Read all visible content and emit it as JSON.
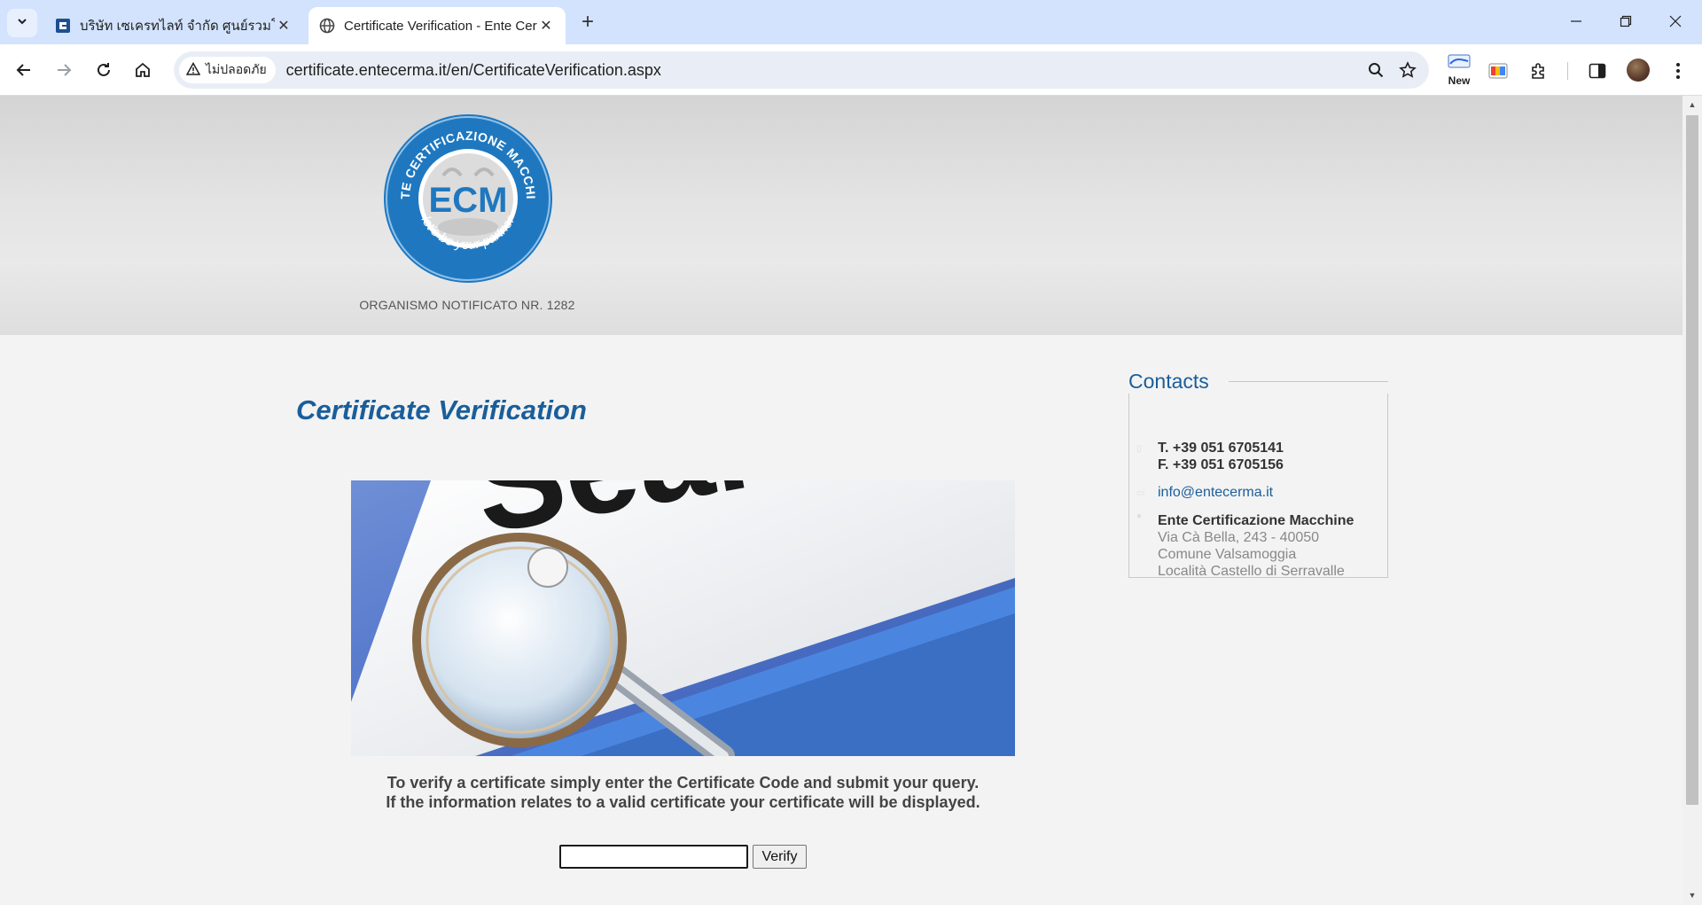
{
  "browser": {
    "tabs": [
      {
        "title": "บริษัท เซเครทไลท์ จำกัด ศูนย์รวมโคมไฟ",
        "active": false
      },
      {
        "title": "Certificate Verification - Ente Certificazione Macchine",
        "active": true
      }
    ],
    "address_bar": {
      "security_label": "ไม่ปลอดภัย",
      "url": "certificate.entecerma.it/en/CertificateVerification.aspx"
    },
    "extension_badge_label": "New",
    "icons": [
      "tab-search-icon",
      "close-icon",
      "new-tab-icon",
      "minimize-icon",
      "restore-icon",
      "back-icon",
      "forward-icon",
      "reload-icon",
      "home-icon",
      "warning-icon",
      "search-icon",
      "star-icon",
      "extensions-icon",
      "side-panel-icon",
      "menu-icon"
    ]
  },
  "header": {
    "logo": {
      "ring_text_top": "ENTE CERTIFICAZIONE MACCHINE",
      "ring_text_bottom": "let's be your partner",
      "center_text": "ECM"
    },
    "notified_body": "ORGANISMO NOTIFICATO NR. 1282"
  },
  "main": {
    "title": "Certificate Verification",
    "hero_image_text": "Search...",
    "instructions_line1": "To verify a certificate simply enter the Certificate Code and submit your query.",
    "instructions_line2": "If the information relates to a valid certificate your certificate will be displayed.",
    "input": {
      "value": "",
      "placeholder": ""
    },
    "verify_label": "Verify"
  },
  "contacts": {
    "title": "Contacts",
    "phone": "T. +39 051 6705141",
    "fax": "F. +39 051 6705156",
    "email": "info@entecerma.it",
    "company": "Ente Certificazione Macchine",
    "address_line1": "Via Cà Bella, 243 - 40050",
    "address_line2": "Comune Valsamoggia",
    "address_line3": "Località Castello di Serravalle"
  },
  "colors": {
    "accent": "#1a5e9a",
    "tabstrip": "#d3e3fd",
    "logo_blue": "#1f78bf"
  }
}
